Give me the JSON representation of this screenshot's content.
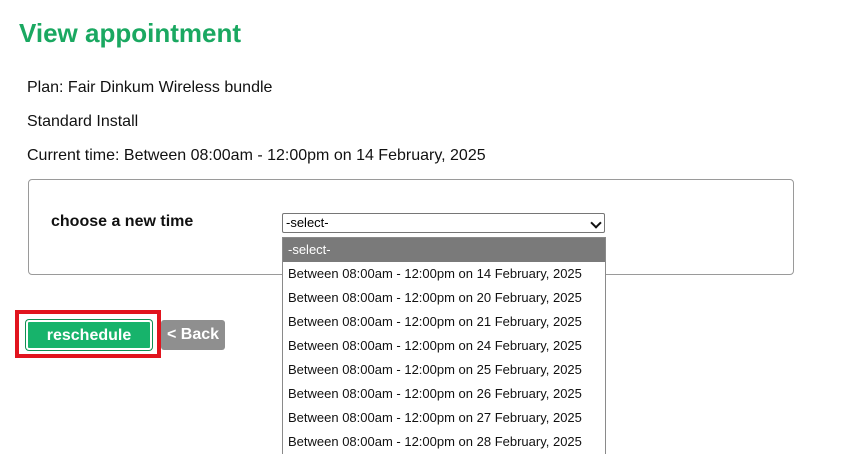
{
  "page": {
    "title": "View appointment"
  },
  "appointment": {
    "plan": "Plan: Fair Dinkum Wireless bundle",
    "install_type": "Standard Install",
    "current_time": "Current time: Between 08:00am - 12:00pm on 14 February, 2025"
  },
  "reschedule_form": {
    "label": "choose a new time",
    "select_value": "-select-",
    "options": [
      "-select-",
      "Between 08:00am - 12:00pm on 14 February, 2025",
      "Between 08:00am - 12:00pm on 20 February, 2025",
      "Between 08:00am - 12:00pm on 21 February, 2025",
      "Between 08:00am - 12:00pm on 24 February, 2025",
      "Between 08:00am - 12:00pm on 25 February, 2025",
      "Between 08:00am - 12:00pm on 26 February, 2025",
      "Between 08:00am - 12:00pm on 27 February, 2025",
      "Between 08:00am - 12:00pm on 28 February, 2025"
    ]
  },
  "buttons": {
    "reschedule": "reschedule",
    "back": "< Back"
  },
  "colors": {
    "title_green": "#1aa861",
    "button_green": "#17b36b",
    "highlight_red": "#e1141e",
    "back_gray": "#8f8f8f"
  }
}
